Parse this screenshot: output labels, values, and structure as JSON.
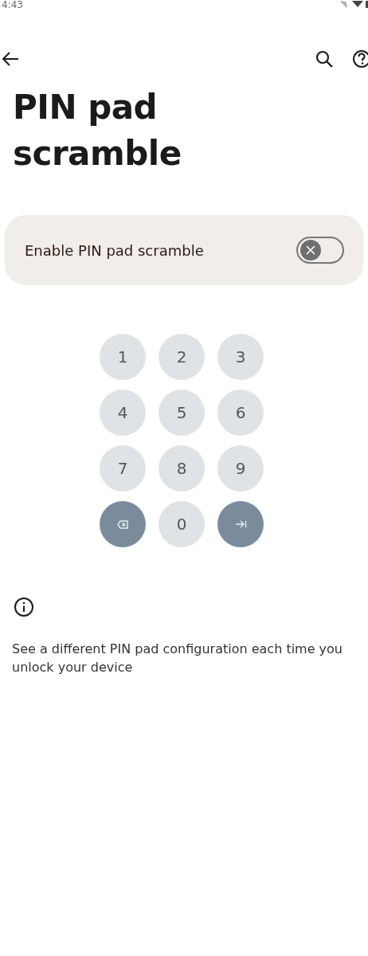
{
  "status_bar": {
    "time": "4:43"
  },
  "title": "PIN pad scramble",
  "setting": {
    "label": "Enable PIN pad scramble",
    "on": false
  },
  "keypad": [
    {
      "kind": "digit",
      "label": "1"
    },
    {
      "kind": "digit",
      "label": "2"
    },
    {
      "kind": "digit",
      "label": "3"
    },
    {
      "kind": "digit",
      "label": "4"
    },
    {
      "kind": "digit",
      "label": "5"
    },
    {
      "kind": "digit",
      "label": "6"
    },
    {
      "kind": "digit",
      "label": "7"
    },
    {
      "kind": "digit",
      "label": "8"
    },
    {
      "kind": "digit",
      "label": "9"
    },
    {
      "kind": "backspace"
    },
    {
      "kind": "digit",
      "label": "0"
    },
    {
      "kind": "enter"
    }
  ],
  "info": "See a different PIN pad configuration each time you unlock your device"
}
